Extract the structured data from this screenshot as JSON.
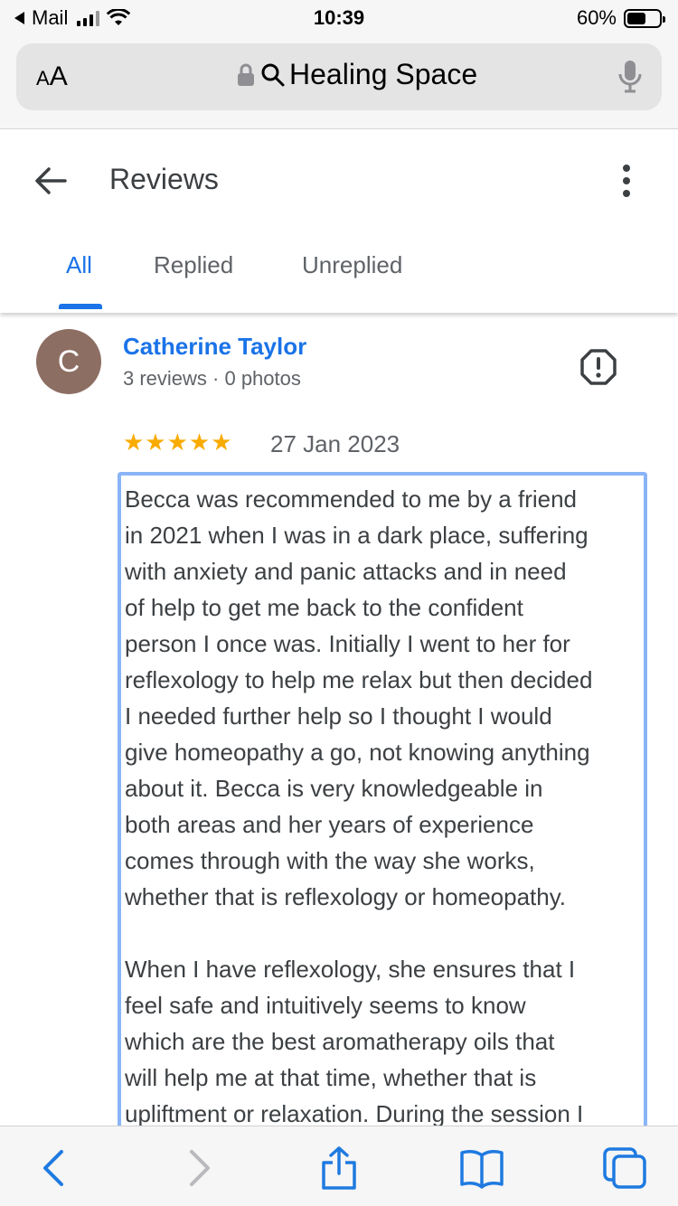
{
  "status_bar": {
    "back_app": "Mail",
    "time": "10:39",
    "battery_percent": "60%",
    "battery_level": 0.6
  },
  "address_bar": {
    "text_size_small": "A",
    "text_size_big": "A",
    "query": "Healing Space"
  },
  "header": {
    "title": "Reviews"
  },
  "tabs": [
    {
      "label": "All",
      "active": true
    },
    {
      "label": "Replied",
      "active": false
    },
    {
      "label": "Unreplied",
      "active": false
    }
  ],
  "review": {
    "avatar_initial": "C",
    "avatar_color": "#8d6e63",
    "name": "Catherine Taylor",
    "meta": "3 reviews · 0 photos",
    "rating": 5,
    "stars": "★★★★★",
    "date": "27 Jan 2023",
    "text": "Becca was recommended to me by a friend\nin 2021 when I was in a dark place, suffering\nwith anxiety and panic attacks and in need\nof help to get me back to the confident\nperson I once was. Initially I went to her for\nreflexology to help me relax but then decided\nI needed further help so I thought I would\ngive homeopathy a go, not knowing anything\nabout it. Becca is very knowledgeable in\nboth areas and her years of experience\ncomes through with the way she works,\nwhether that is reflexology or homeopathy.\n\nWhen I have reflexology, she ensures that I\nfeel safe and intuitively seems to know\nwhich are the best aromatherapy oils that\nwill help me at that time, whether that is\nupliftment or relaxation. During the session I"
  },
  "colors": {
    "accent": "#1a73e8",
    "star": "#f9ab00",
    "selection_border": "#8ab4f8",
    "safari_blue": "#1f7ae0"
  },
  "icons": {
    "back": "arrow-left-icon",
    "more": "more-vert-icon",
    "flag": "report-icon",
    "lock": "lock-icon",
    "search": "search-icon",
    "mic": "mic-icon",
    "nav_back": "chevron-left-icon",
    "nav_forward": "chevron-right-icon",
    "share": "share-icon",
    "bookmarks": "book-icon",
    "tabs": "tabs-icon"
  }
}
